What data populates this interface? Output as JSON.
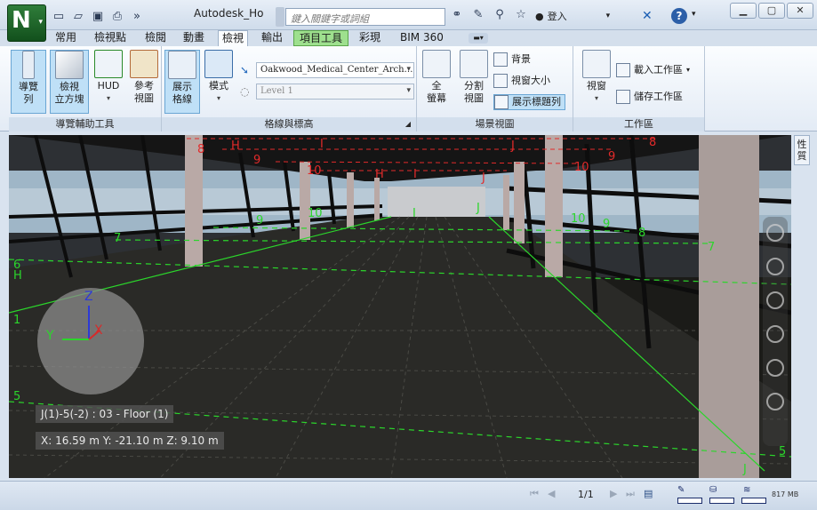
{
  "titlebar": {
    "app_letter": "N",
    "title": "Autodesk_Ho",
    "search_placeholder": "鍵入關鍵字或詞組",
    "login_label": "登入",
    "help": "?",
    "quick_access": [
      "new-icon",
      "open-icon",
      "save-icon",
      "print-icon",
      "more-icon"
    ],
    "toolbar_icons": [
      "binoculars-icon",
      "wrench-icon",
      "satellite-icon",
      "star-icon",
      "user-icon"
    ]
  },
  "tabs": [
    "常用",
    "檢視點",
    "檢閱",
    "動畫",
    "檢視",
    "輸出",
    "項目工具",
    "彩現",
    "BIM 360"
  ],
  "ribbon": {
    "group1": {
      "label": "導覽輔助工具",
      "buttons": [
        {
          "line1": "導覽",
          "line2": "列"
        },
        {
          "line1": "檢視",
          "line2": "立方塊"
        },
        {
          "line1": "HUD",
          "line2": ""
        },
        {
          "line1": "參考",
          "line2": "視圖"
        }
      ]
    },
    "group2": {
      "label": "格線與標高",
      "show_grid": {
        "line1": "展示",
        "line2": "格線"
      },
      "mode": "模式",
      "model_combo": "Oakwood_Medical_Center_Arch",
      "level_combo": "Level 1"
    },
    "group3": {
      "label": "場景視圖",
      "fullscreen": {
        "line1": "全",
        "line2": "螢幕"
      },
      "split": {
        "line1": "分割",
        "line2": "視圖"
      },
      "background": "背景",
      "window_size": "視窗大小",
      "show_title_bar": "展示標題列"
    },
    "group4": {
      "label": "工作區",
      "windows": "視窗",
      "load_workspace": "載入工作區",
      "save_workspace": "儲存工作區"
    }
  },
  "side_panel_label": "性質",
  "viewport": {
    "grid_location": "J(1)-5(-2) : 03 - Floor (1)",
    "coordinates": "X: 16.59 m  Y: -21.10 m  Z: 9.10 m",
    "axis_labels": {
      "z": "Z",
      "y": "Y",
      "x": "X"
    },
    "grid_labels_red": [
      "8",
      "H",
      "I",
      "J",
      "8",
      "9",
      "10",
      "H",
      "I",
      "J",
      "10",
      "9"
    ],
    "grid_labels_green": [
      "7",
      "6",
      "H",
      "9",
      "10",
      "I",
      "J",
      "10",
      "9",
      "8",
      "7",
      "1",
      "5",
      "5",
      "J"
    ]
  },
  "status": {
    "page": "1/1",
    "memory": "817 MB"
  },
  "colors": {
    "accent_green": "#1f6e2a",
    "grid_red": "#e22a2a",
    "grid_green": "#2bd62b"
  }
}
